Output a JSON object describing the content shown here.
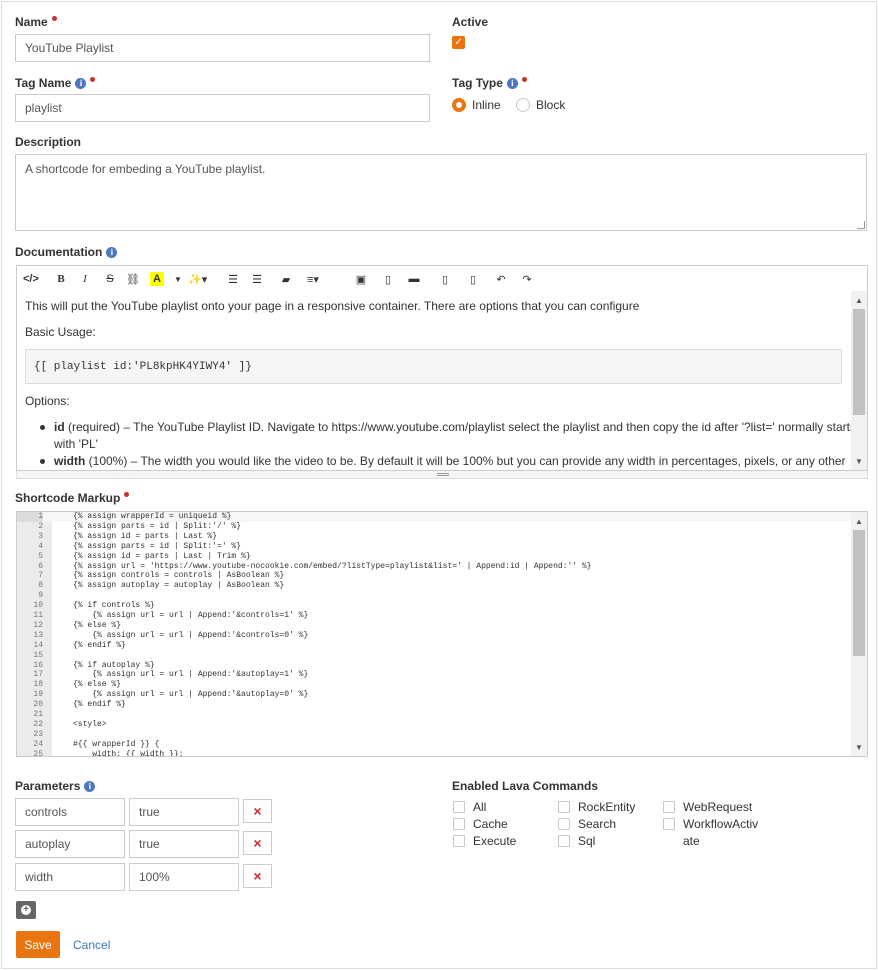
{
  "form": {
    "name": {
      "label": "Name",
      "value": "YouTube Playlist"
    },
    "active": {
      "label": "Active",
      "checked": true
    },
    "tag_name": {
      "label": "Tag Name",
      "value": "playlist"
    },
    "tag_type": {
      "label": "Tag Type",
      "options": [
        "Inline",
        "Block"
      ],
      "selected": "Inline"
    },
    "description": {
      "label": "Description",
      "value": "A shortcode for embeding a YouTube playlist."
    },
    "documentation": {
      "label": "Documentation",
      "intro": "This will put the YouTube playlist onto your page in a responsive container. There are options that you can configure",
      "basic_usage": "Basic Usage:",
      "code": "{[ playlist id:'PL8kpHK4YIWY4' ]}",
      "options_heading": "Options:",
      "options": [
        {
          "key": "id",
          "text": " (required) – The YouTube Playlist ID. Navigate to https://www.youtube.com/playlist select the playlist and then copy the id after '?list=' normally starts",
          "text2": "with 'PL'"
        },
        {
          "key": "width",
          "text": " (100%) – The width you would like the video to be. By default it will be 100% but you can provide any width in percentages, pixels, or any other"
        }
      ]
    },
    "shortcode_markup": {
      "label": "Shortcode Markup",
      "lines": [
        "{% assign wrapperId = uniqueid %}",
        "{% assign parts = id | Split:'/' %}",
        "{% assign id = parts | Last %}",
        "{% assign parts = id | Split:'=' %}",
        "{% assign id = parts | Last | Trim %}",
        "{% assign url = 'https://www.youtube-nocookie.com/embed/?listType=playlist&list=' | Append:id | Append:'' %}",
        "{% assign controls = controls | AsBoolean %}",
        "{% assign autoplay = autoplay | AsBoolean %}",
        "",
        "{% if controls %}",
        "    {% assign url = url | Append:'&controls=1' %}",
        "{% else %}",
        "    {% assign url = url | Append:'&controls=0' %}",
        "{% endif %}",
        "",
        "{% if autoplay %}",
        "    {% assign url = url | Append:'&autoplay=1' %}",
        "{% else %}",
        "    {% assign url = url | Append:'&autoplay=0' %}",
        "{% endif %}",
        "",
        "<style>",
        "",
        "#{{ wrapperId }} {",
        "    width: {{ width }};"
      ]
    },
    "parameters": {
      "label": "Parameters",
      "rows": [
        {
          "key": "controls",
          "value": "true"
        },
        {
          "key": "autoplay",
          "value": "true"
        },
        {
          "key": "width",
          "value": "100%"
        }
      ]
    },
    "lava_commands": {
      "label": "Enabled Lava Commands",
      "columns": [
        [
          "All",
          "Cache",
          "Execute"
        ],
        [
          "RockEntity",
          "Search",
          "Sql"
        ],
        [
          "WebRequest",
          "WorkflowActiv"
        ]
      ],
      "wrap_text": "ate"
    },
    "actions": {
      "save": "Save",
      "cancel": "Cancel"
    }
  },
  "colors": {
    "accent": "#e97511",
    "required": "#c9312a",
    "link": "#3a78c2"
  }
}
